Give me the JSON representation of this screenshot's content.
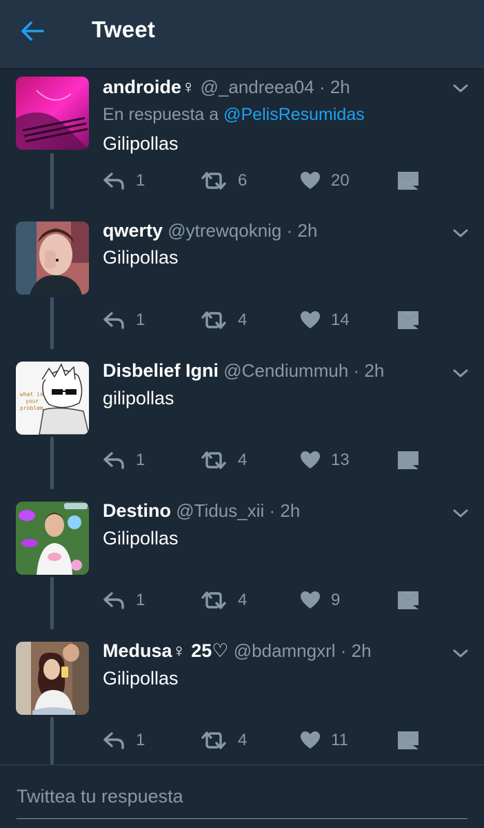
{
  "header": {
    "title": "Tweet",
    "back_icon": "arrow-left-icon",
    "accent": "#1da1f2"
  },
  "tweets": [
    {
      "display_name": "androide♀",
      "handle": "@_andreea04",
      "time": "2h",
      "reply_prefix": "En respuesta a",
      "reply_mention": "@PelisResumidas",
      "text": "Gilipollas",
      "replies": "1",
      "retweets": "6",
      "likes": "20"
    },
    {
      "display_name": "qwerty",
      "handle": "@ytrewqoknig",
      "time": "2h",
      "text": "Gilipollas",
      "replies": "1",
      "retweets": "4",
      "likes": "14"
    },
    {
      "display_name": "Disbelief Igni",
      "handle": "@Cendiummuh",
      "time": "2h",
      "text": "gilipollas",
      "replies": "1",
      "retweets": "4",
      "likes": "13",
      "avatar_text": [
        "what is",
        "your",
        "problem"
      ]
    },
    {
      "display_name": "Destino",
      "handle": "@Tidus_xii",
      "time": "2h",
      "text": "Gilipollas",
      "replies": "1",
      "retweets": "4",
      "likes": "9"
    },
    {
      "display_name": "Medusa♀ 25♡",
      "handle": "@bdamngxrl",
      "time": "2h",
      "text": "Gilipollas",
      "replies": "1",
      "retweets": "4",
      "likes": "11"
    }
  ],
  "composer": {
    "placeholder": "Twittea tu respuesta"
  },
  "icons": [
    "reply-icon",
    "retweet-icon",
    "heart-icon",
    "direct-message-icon",
    "chevron-down-icon"
  ]
}
